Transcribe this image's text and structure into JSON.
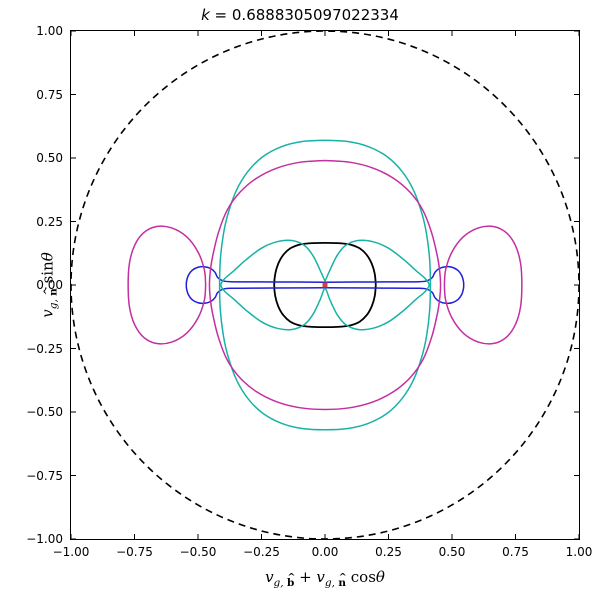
{
  "chart_data": {
    "type": "line",
    "title": "k =  0.6888305097022334",
    "xlabel": "v_{g,\\hat b} + v_{g,\\hat n} cos\\theta",
    "ylabel": "v_{g,\\hat n} sin\\theta",
    "xlim": [
      -1.0,
      1.0
    ],
    "ylim": [
      -1.0,
      1.0
    ],
    "xticks": [
      -1.0,
      -0.75,
      -0.5,
      -0.25,
      0.0,
      0.25,
      0.5,
      0.75,
      1.0
    ],
    "yticks": [
      -1.0,
      -0.75,
      -0.5,
      -0.25,
      0.0,
      0.25,
      0.5,
      0.75,
      1.0
    ],
    "series": [
      {
        "name": "unit-circle",
        "style": "dashed",
        "color": "#000000",
        "shape": "parametric-circle",
        "center": [
          0.0,
          0.0
        ],
        "radius": 1.0
      },
      {
        "name": "black-ellipse",
        "style": "solid",
        "color": "#000000",
        "shape": "closed-curve",
        "points": [
          [
            0.2,
            0.0
          ],
          [
            0.196,
            0.043
          ],
          [
            0.184,
            0.084
          ],
          [
            0.164,
            0.119
          ],
          [
            0.137,
            0.144
          ],
          [
            0.104,
            0.158
          ],
          [
            0.083,
            0.162
          ],
          [
            0.05,
            0.165
          ],
          [
            0.0,
            0.166
          ],
          [
            -0.05,
            0.165
          ],
          [
            -0.083,
            0.162
          ],
          [
            -0.104,
            0.158
          ],
          [
            -0.137,
            0.144
          ],
          [
            -0.164,
            0.119
          ],
          [
            -0.184,
            0.084
          ],
          [
            -0.196,
            0.043
          ],
          [
            -0.2,
            0.0
          ],
          [
            -0.196,
            -0.043
          ],
          [
            -0.184,
            -0.084
          ],
          [
            -0.164,
            -0.119
          ],
          [
            -0.137,
            -0.144
          ],
          [
            -0.104,
            -0.158
          ],
          [
            -0.083,
            -0.162
          ],
          [
            -0.05,
            -0.165
          ],
          [
            0.0,
            -0.166
          ],
          [
            0.05,
            -0.165
          ],
          [
            0.083,
            -0.162
          ],
          [
            0.104,
            -0.158
          ],
          [
            0.137,
            -0.144
          ],
          [
            0.164,
            -0.119
          ],
          [
            0.184,
            -0.084
          ],
          [
            0.196,
            -0.043
          ],
          [
            0.2,
            0.0
          ]
        ]
      },
      {
        "name": "blue-curve",
        "style": "solid",
        "color": "#1f1fd4",
        "shape": "closed-curve",
        "points": [
          [
            0.0,
            0.011
          ],
          [
            0.2,
            0.012
          ],
          [
            0.37,
            0.013
          ],
          [
            0.405,
            0.018
          ],
          [
            0.423,
            0.03
          ],
          [
            0.433,
            0.05
          ],
          [
            0.45,
            0.065
          ],
          [
            0.475,
            0.072
          ],
          [
            0.5,
            0.07
          ],
          [
            0.523,
            0.058
          ],
          [
            0.538,
            0.038
          ],
          [
            0.545,
            0.015
          ],
          [
            0.546,
            0.0
          ],
          [
            0.545,
            -0.015
          ],
          [
            0.538,
            -0.038
          ],
          [
            0.523,
            -0.058
          ],
          [
            0.5,
            -0.07
          ],
          [
            0.475,
            -0.072
          ],
          [
            0.45,
            -0.065
          ],
          [
            0.433,
            -0.05
          ],
          [
            0.423,
            -0.03
          ],
          [
            0.405,
            -0.018
          ],
          [
            0.37,
            -0.013
          ],
          [
            0.2,
            -0.012
          ],
          [
            0.0,
            -0.011
          ],
          [
            -0.2,
            -0.012
          ],
          [
            -0.37,
            -0.013
          ],
          [
            -0.405,
            -0.018
          ],
          [
            -0.423,
            -0.03
          ],
          [
            -0.433,
            -0.05
          ],
          [
            -0.45,
            -0.065
          ],
          [
            -0.475,
            -0.072
          ],
          [
            -0.5,
            -0.07
          ],
          [
            -0.523,
            -0.058
          ],
          [
            -0.538,
            -0.038
          ],
          [
            -0.545,
            -0.015
          ],
          [
            -0.546,
            0.0
          ],
          [
            -0.545,
            0.015
          ],
          [
            -0.538,
            0.038
          ],
          [
            -0.523,
            0.058
          ],
          [
            -0.5,
            0.07
          ],
          [
            -0.475,
            0.072
          ],
          [
            -0.45,
            0.065
          ],
          [
            -0.433,
            0.05
          ],
          [
            -0.423,
            0.03
          ],
          [
            -0.405,
            0.018
          ],
          [
            -0.37,
            0.013
          ],
          [
            -0.2,
            0.012
          ],
          [
            0.0,
            0.011
          ]
        ]
      },
      {
        "name": "teal-outer",
        "style": "solid",
        "color": "#19b2a6",
        "shape": "closed-curve",
        "points": [
          [
            0.0,
            0.57
          ],
          [
            0.09,
            0.565
          ],
          [
            0.17,
            0.545
          ],
          [
            0.245,
            0.505
          ],
          [
            0.305,
            0.445
          ],
          [
            0.35,
            0.37
          ],
          [
            0.382,
            0.28
          ],
          [
            0.4,
            0.2
          ],
          [
            0.412,
            0.1
          ],
          [
            0.415,
            0.0
          ],
          [
            0.412,
            -0.1
          ],
          [
            0.4,
            -0.2
          ],
          [
            0.382,
            -0.28
          ],
          [
            0.35,
            -0.37
          ],
          [
            0.305,
            -0.445
          ],
          [
            0.245,
            -0.505
          ],
          [
            0.17,
            -0.545
          ],
          [
            0.09,
            -0.565
          ],
          [
            0.0,
            -0.57
          ],
          [
            -0.09,
            -0.565
          ],
          [
            -0.17,
            -0.545
          ],
          [
            -0.245,
            -0.505
          ],
          [
            -0.305,
            -0.445
          ],
          [
            -0.35,
            -0.37
          ],
          [
            -0.382,
            -0.28
          ],
          [
            -0.4,
            -0.2
          ],
          [
            -0.412,
            -0.1
          ],
          [
            -0.415,
            0.0
          ],
          [
            -0.412,
            0.1
          ],
          [
            -0.4,
            0.2
          ],
          [
            -0.382,
            0.28
          ],
          [
            -0.35,
            0.37
          ],
          [
            -0.305,
            0.445
          ],
          [
            -0.245,
            0.505
          ],
          [
            -0.17,
            0.545
          ],
          [
            -0.09,
            0.565
          ],
          [
            0.0,
            0.57
          ]
        ]
      },
      {
        "name": "teal-inner",
        "style": "solid",
        "color": "#19b2a6",
        "shape": "closed-curve",
        "points": [
          [
            0.0,
            0.015
          ],
          [
            0.02,
            0.06
          ],
          [
            0.047,
            0.115
          ],
          [
            0.08,
            0.155
          ],
          [
            0.13,
            0.175
          ],
          [
            0.19,
            0.17
          ],
          [
            0.25,
            0.145
          ],
          [
            0.31,
            0.1
          ],
          [
            0.36,
            0.055
          ],
          [
            0.395,
            0.025
          ],
          [
            0.41,
            0.0
          ],
          [
            0.395,
            -0.025
          ],
          [
            0.36,
            -0.055
          ],
          [
            0.31,
            -0.1
          ],
          [
            0.25,
            -0.145
          ],
          [
            0.19,
            -0.17
          ],
          [
            0.13,
            -0.175
          ],
          [
            0.08,
            -0.155
          ],
          [
            0.047,
            -0.115
          ],
          [
            0.02,
            -0.06
          ],
          [
            0.0,
            -0.015
          ],
          [
            -0.02,
            -0.06
          ],
          [
            -0.047,
            -0.115
          ],
          [
            -0.08,
            -0.155
          ],
          [
            -0.13,
            -0.175
          ],
          [
            -0.19,
            -0.17
          ],
          [
            -0.25,
            -0.145
          ],
          [
            -0.31,
            -0.1
          ],
          [
            -0.36,
            -0.055
          ],
          [
            -0.395,
            -0.025
          ],
          [
            -0.41,
            0.0
          ],
          [
            -0.395,
            0.025
          ],
          [
            -0.36,
            0.055
          ],
          [
            -0.31,
            0.1
          ],
          [
            -0.25,
            0.145
          ],
          [
            -0.19,
            0.17
          ],
          [
            -0.13,
            0.175
          ],
          [
            -0.08,
            0.155
          ],
          [
            -0.047,
            0.115
          ],
          [
            -0.02,
            0.06
          ],
          [
            0.0,
            0.015
          ]
        ]
      },
      {
        "name": "magenta-outer",
        "style": "solid",
        "color": "#c32fa0",
        "shape": "closed-curve",
        "points": [
          [
            0.0,
            0.49
          ],
          [
            0.1,
            0.483
          ],
          [
            0.19,
            0.46
          ],
          [
            0.27,
            0.42
          ],
          [
            0.335,
            0.365
          ],
          [
            0.385,
            0.295
          ],
          [
            0.42,
            0.205
          ],
          [
            0.443,
            0.11
          ],
          [
            0.452,
            0.05
          ],
          [
            0.455,
            0.0
          ],
          [
            0.452,
            -0.05
          ],
          [
            0.443,
            -0.11
          ],
          [
            0.42,
            -0.205
          ],
          [
            0.385,
            -0.295
          ],
          [
            0.335,
            -0.365
          ],
          [
            0.27,
            -0.42
          ],
          [
            0.19,
            -0.46
          ],
          [
            0.1,
            -0.483
          ],
          [
            0.0,
            -0.49
          ],
          [
            -0.1,
            -0.483
          ],
          [
            -0.19,
            -0.46
          ],
          [
            -0.27,
            -0.42
          ],
          [
            -0.335,
            -0.365
          ],
          [
            -0.385,
            -0.295
          ],
          [
            -0.42,
            -0.205
          ],
          [
            -0.443,
            -0.11
          ],
          [
            -0.452,
            -0.05
          ],
          [
            -0.455,
            0.0
          ],
          [
            -0.452,
            0.05
          ],
          [
            -0.443,
            0.11
          ],
          [
            -0.42,
            0.205
          ],
          [
            -0.385,
            0.295
          ],
          [
            -0.335,
            0.365
          ],
          [
            -0.27,
            0.42
          ],
          [
            -0.19,
            0.46
          ],
          [
            -0.1,
            0.483
          ],
          [
            0.0,
            0.49
          ]
        ]
      },
      {
        "name": "magenta-right-lobe",
        "style": "solid",
        "color": "#c32fa0",
        "shape": "closed-curve",
        "points": [
          [
            0.47,
            0.0
          ],
          [
            0.475,
            0.06
          ],
          [
            0.5,
            0.13
          ],
          [
            0.545,
            0.19
          ],
          [
            0.605,
            0.225
          ],
          [
            0.665,
            0.23
          ],
          [
            0.715,
            0.205
          ],
          [
            0.75,
            0.155
          ],
          [
            0.77,
            0.085
          ],
          [
            0.775,
            0.0
          ],
          [
            0.77,
            -0.085
          ],
          [
            0.75,
            -0.155
          ],
          [
            0.715,
            -0.205
          ],
          [
            0.665,
            -0.23
          ],
          [
            0.605,
            -0.225
          ],
          [
            0.545,
            -0.19
          ],
          [
            0.5,
            -0.13
          ],
          [
            0.475,
            -0.06
          ],
          [
            0.47,
            0.0
          ]
        ]
      },
      {
        "name": "magenta-left-lobe",
        "style": "solid",
        "color": "#c32fa0",
        "shape": "closed-curve",
        "points": [
          [
            -0.47,
            0.0
          ],
          [
            -0.475,
            0.06
          ],
          [
            -0.5,
            0.13
          ],
          [
            -0.545,
            0.19
          ],
          [
            -0.605,
            0.225
          ],
          [
            -0.665,
            0.23
          ],
          [
            -0.715,
            0.205
          ],
          [
            -0.75,
            0.155
          ],
          [
            -0.77,
            0.085
          ],
          [
            -0.775,
            0.0
          ],
          [
            -0.77,
            -0.085
          ],
          [
            -0.75,
            -0.155
          ],
          [
            -0.715,
            -0.205
          ],
          [
            -0.665,
            -0.23
          ],
          [
            -0.605,
            -0.225
          ],
          [
            -0.545,
            -0.19
          ],
          [
            -0.5,
            -0.13
          ],
          [
            -0.475,
            -0.06
          ],
          [
            -0.47,
            0.0
          ]
        ]
      },
      {
        "name": "center-marker",
        "style": "marker",
        "color": "#d04040",
        "points": [
          [
            0.0,
            0.0
          ]
        ]
      }
    ]
  },
  "labels": {
    "title_prefix": "k",
    "title_eq": " =  ",
    "title_value": "0.6888305097022334",
    "xlabel_html": "<i>v</i><sub><i>g</i>, <span class='hat'>b</span></sub> + <i>v</i><sub><i>g</i>, <span class='hat'>n</span></sub> <span class='rm'>cos</span><i>&theta;</i>",
    "ylabel_html": "<i>v</i><sub><i>g</i>, <span class='hat'>n</span></sub> <span class='rm'>sin</span><i>&theta;</i>"
  },
  "tick_labels": {
    "x": [
      "−1.00",
      "−0.75",
      "−0.50",
      "−0.25",
      "0.00",
      "0.25",
      "0.50",
      "0.75",
      "1.00"
    ],
    "y": [
      "−1.00",
      "−0.75",
      "−0.50",
      "−0.25",
      "0.00",
      "0.25",
      "0.50",
      "0.75",
      "1.00"
    ]
  }
}
